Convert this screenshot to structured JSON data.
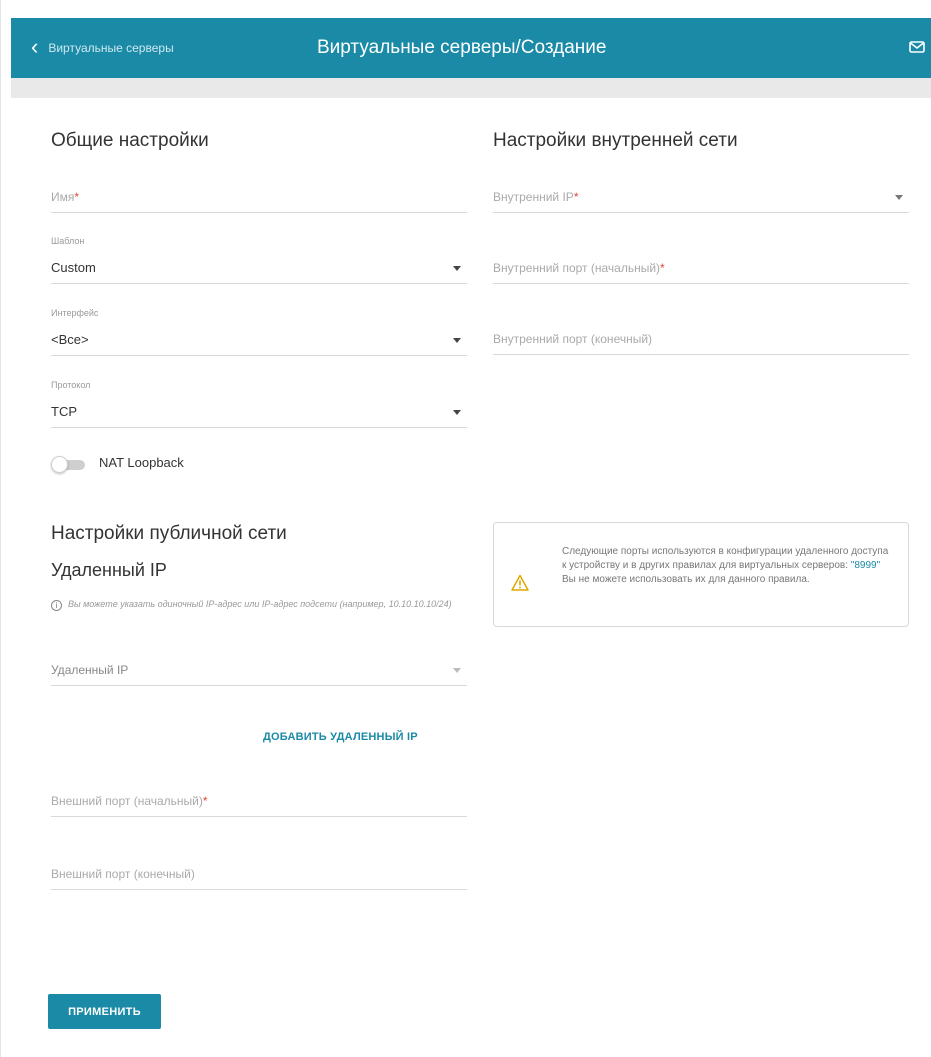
{
  "header": {
    "back_label": "Виртуальные серверы",
    "title": "Виртуальные серверы/Создание",
    "accent_color": "#1a8aa6"
  },
  "general": {
    "section_title": "Общие настройки",
    "name_placeholder": "Имя",
    "template_label": "Шаблон",
    "template_value": "Custom",
    "interface_label": "Интерфейс",
    "interface_value": "<Все>",
    "protocol_label": "Протокол",
    "protocol_value": "TCP",
    "nat_loopback_label": "NAT Loopback",
    "nat_loopback_on": false
  },
  "internal": {
    "section_title": "Настройки внутренней сети",
    "internal_ip_placeholder": "Внутренний IP",
    "port_start_placeholder": "Внутренний порт (начальный)",
    "port_end_placeholder": "Внутренний порт (конечный)"
  },
  "public": {
    "section_title": "Настройки публичной сети",
    "remote_ip_title": "Удаленный IP",
    "hint": "Вы можете указать одиночный IP-адрес или IP-адрес подсети (например, 10.10.10.10/24)",
    "remote_ip_placeholder": "Удаленный IP",
    "add_remote_ip_label": "ДОБАВИТЬ УДАЛЕННЫЙ IP",
    "ext_port_start_placeholder": "Внешний порт (начальный)",
    "ext_port_end_placeholder": "Внешний порт (конечный)"
  },
  "warning": {
    "text_before": "Следующие порты используются в конфигурации удаленного доступа к устройству и в других правилах для виртуальных серверов: ",
    "ports": "\"8999\"",
    "text_after": "Вы не можете использовать их для данного правила."
  },
  "required_mark": "*",
  "apply_label": "ПРИМЕНИТЬ",
  "icons": {
    "back": "chevron-left-icon",
    "mail": "mail-icon",
    "warning": "warning-icon",
    "info": "info-icon"
  }
}
